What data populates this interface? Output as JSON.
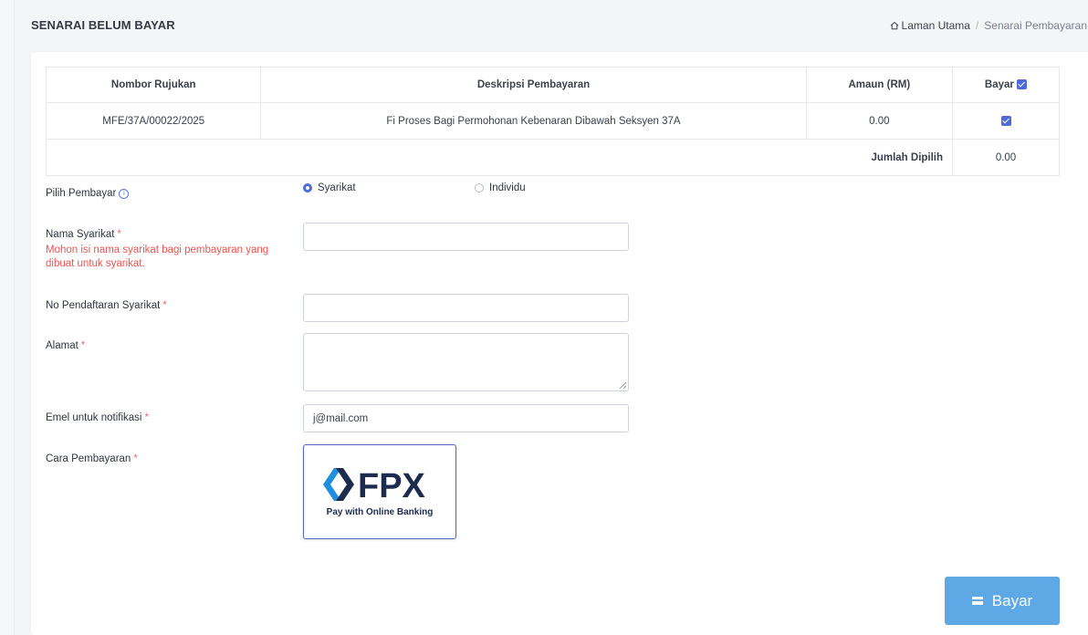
{
  "header": {
    "title": "SENARAI BELUM BAYAR",
    "breadcrumb_home": "Laman Utama",
    "breadcrumb_separator": "/",
    "breadcrumb_current": "Senarai Pembayaran"
  },
  "table": {
    "headers": {
      "ref": "Nombor Rujukan",
      "desc": "Deskripsi Pembayaran",
      "amount": "Amaun (RM)",
      "pay": "Bayar"
    },
    "rows": [
      {
        "ref": "MFE/37A/00022/2025",
        "desc": "Fi Proses Bagi Permohonan Kebenaran Dibawah Seksyen 37A",
        "amount": "0.00",
        "checked": true
      }
    ],
    "total_label": "Jumlah Dipilih",
    "total_value": "0.00"
  },
  "form": {
    "payer_label": "Pilih Pembayar",
    "payer_options": [
      "Syarikat",
      "Individu"
    ],
    "payer_selected": "Syarikat",
    "company_name_label": "Nama Syarikat",
    "company_name_hint": "Mohon isi nama syarikat bagi pembayaran yang dibuat untuk syarikat.",
    "company_name_value": "",
    "company_reg_label": "No Pendaftaran Syarikat",
    "company_reg_value": "",
    "address_label": "Alamat",
    "address_value": "",
    "email_label": "Emel untuk notifikasi",
    "email_value": "j@mail.com",
    "payment_method_label": "Cara Pembayaran",
    "required_mark": "*"
  },
  "fpx": {
    "logo_text": "FPX",
    "tagline": "Pay with Online Banking"
  },
  "actions": {
    "pay_button": "Bayar"
  },
  "icons": {
    "home": "home-icon",
    "info": "info-icon",
    "card": "credit-card-icon"
  },
  "colors": {
    "accent": "#4f6ad9",
    "button": "#5fa8e6",
    "error": "#ef5350",
    "fpx_navy": "#1d2b4f",
    "fpx_blue": "#1d8ee0"
  }
}
